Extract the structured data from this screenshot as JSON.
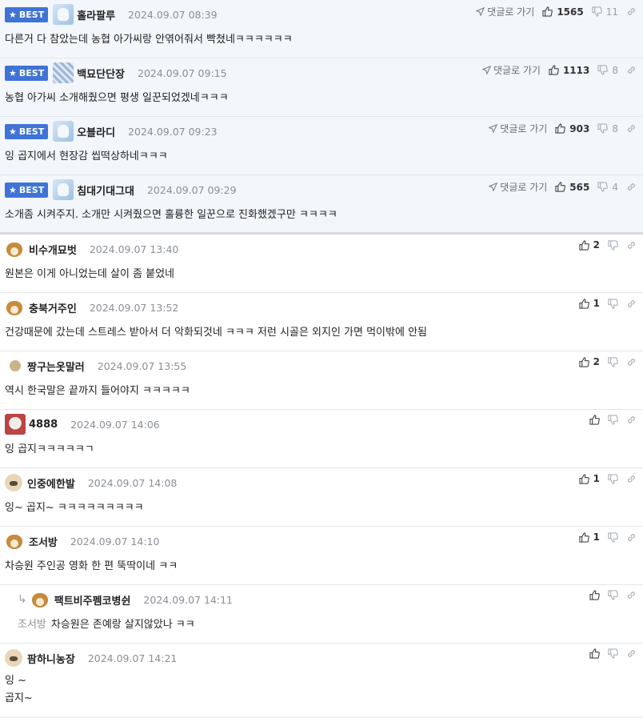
{
  "labels": {
    "best": "BEST",
    "reply_to": "댓글로 가기"
  },
  "comments": [
    {
      "nick": "홀라팔루",
      "date": "2024.09.07 08:39",
      "text": "다른거 다 참았는데 농협 아가씨랑 안엮어줘서 빡쳤네ㅋㅋㅋㅋㅋㅋ",
      "up": "1565",
      "down": "11"
    },
    {
      "nick": "백묘단단장",
      "date": "2024.09.07 09:15",
      "text": "농협 아가씨 소개해줬으면 평생 일꾼되었겠네ㅋㅋㅋ",
      "up": "1113",
      "down": "8"
    },
    {
      "nick": "오블라디",
      "date": "2024.09.07 09:23",
      "text": "잉 곱지에서 현장감 씹떡상하네ㅋㅋㅋ",
      "up": "903",
      "down": "8"
    },
    {
      "nick": "침대기대그대",
      "date": "2024.09.07 09:29",
      "text": "소개좀 시켜주지. 소개만 시켜줬으면 훌륭한 일꾼으로 진화했겠구만 ㅋㅋㅋㅋ",
      "up": "565",
      "down": "4"
    },
    {
      "nick": "비수개묘벗",
      "date": "2024.09.07 13:40",
      "text": "원본은 이게 아니었는데 살이 좀 붙었네",
      "up": "2",
      "down": ""
    },
    {
      "nick": "충북거주인",
      "date": "2024.09.07 13:52",
      "text": "건강때문에 갔는데 스트레스 받아서 더 악화되것네 ㅋㅋㅋ 저런 시골은 외지인 가면 먹이밖에 안됨",
      "up": "1",
      "down": ""
    },
    {
      "nick": "짱구는옷말러",
      "date": "2024.09.07 13:55",
      "text": "역시 한국말은 끝까지 들어야지 ㅋㅋㅋㅋㅋ",
      "up": "2",
      "down": ""
    },
    {
      "nick": "4888",
      "date": "2024.09.07 14:06",
      "text": "잉 곱지ㅋㅋㅋㅋㅋㄱ",
      "up": "",
      "down": ""
    },
    {
      "nick": "인중에한발",
      "date": "2024.09.07 14:08",
      "text": "잉~ 곱지~ ㅋㅋㅋㅋㅋㅋㅋㅋㅋ",
      "up": "1",
      "down": ""
    },
    {
      "nick": "조서방",
      "date": "2024.09.07 14:10",
      "text": "차승원 주인공 영화 한 편 뚝딱이네 ㅋㅋ",
      "up": "1",
      "down": ""
    },
    {
      "nick": "팩트비주펨코병쉰",
      "date": "2024.09.07 14:11",
      "mention": "조서방",
      "text": "차승원은 존예랑 살지않았나 ㅋㅋ",
      "up": "",
      "down": ""
    },
    {
      "nick": "팜하니농장",
      "date": "2024.09.07 14:21",
      "text_line1": "잉 ~",
      "text_line2": "곱지~",
      "up": "",
      "down": ""
    }
  ]
}
